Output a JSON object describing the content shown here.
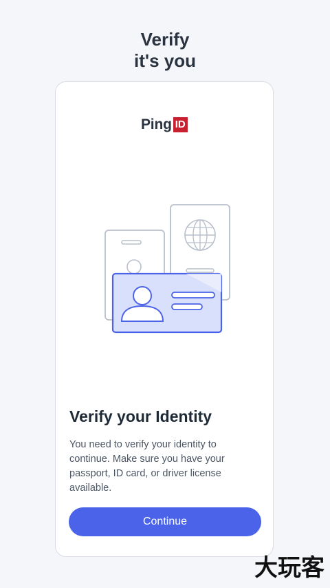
{
  "header": {
    "title_line1": "Verify",
    "title_line2": "it's you"
  },
  "card": {
    "logo": {
      "text": "Ping",
      "badge": "ID",
      "badge_color": "#c8202f"
    },
    "illustration": {
      "icon": "id-documents-illustration"
    },
    "headline": "Verify your Identity",
    "body": "You need to verify your identity to continue. Make sure you have your passport, ID card, or driver license available.",
    "continue_label": "Continue"
  },
  "colors": {
    "accent": "#4b63e8",
    "background": "#f5f6fa",
    "card": "#ffffff"
  },
  "watermark": {
    "text": "大玩客"
  }
}
